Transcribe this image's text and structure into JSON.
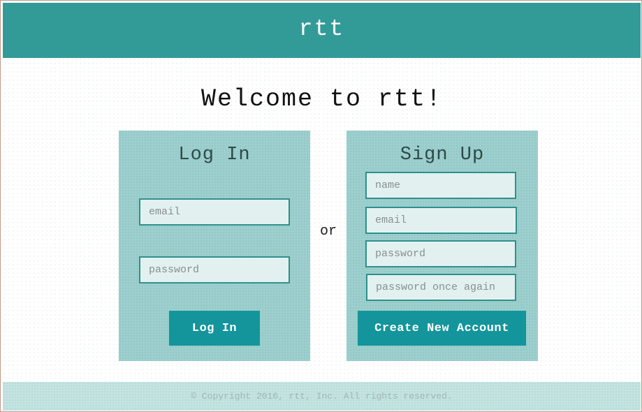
{
  "header": {
    "brand": "rtt"
  },
  "main": {
    "welcome": "Welcome to rtt!",
    "separator": "or"
  },
  "login": {
    "title": "Log In",
    "email_placeholder": "email",
    "password_placeholder": "password",
    "submit_label": "Log In"
  },
  "signup": {
    "title": "Sign Up",
    "name_placeholder": "name",
    "email_placeholder": "email",
    "password_placeholder": "password",
    "password_confirm_placeholder": "password once again",
    "submit_label": "Create New Account"
  },
  "footer": {
    "copyright": "© Copyright 2016, rtt, Inc. All rights reserved."
  },
  "colors": {
    "header_bg": "#339b97",
    "panel_bg": "#9ccfcd",
    "button_bg": "#13959b",
    "field_border": "#2e908c",
    "footer_bg": "#c4e3e1"
  }
}
